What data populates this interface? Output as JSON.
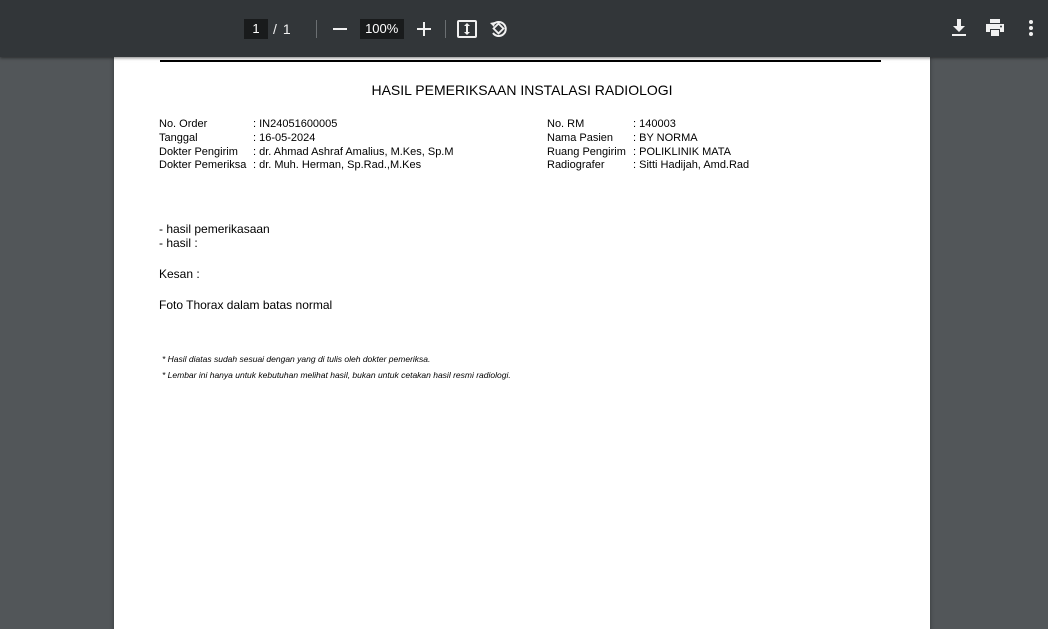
{
  "toolbar": {
    "page_current": "1",
    "page_separator": "/",
    "page_total": "1",
    "zoom": "100%",
    "icons": [
      "minus-icon",
      "plus-icon",
      "fit-page-icon",
      "rotate-icon",
      "download-icon",
      "print-icon",
      "more-vert-icon"
    ]
  },
  "document": {
    "title": "HASIL PEMERIKSAAN INSTALASI RADIOLOGI",
    "left_info": [
      {
        "label": "No. Order",
        "value": ": IN24051600005"
      },
      {
        "label": "Tanggal",
        "value": ": 16-05-2024"
      },
      {
        "label": "Dokter Pengirim",
        "value": ": dr. Ahmad Ashraf Amalius, M.Kes, Sp.M"
      },
      {
        "label": "Dokter Pemeriksa",
        "value": ": dr. Muh. Herman, Sp.Rad.,M.Kes"
      }
    ],
    "right_info": [
      {
        "label": "No. RM",
        "value": ": 140003"
      },
      {
        "label": "Nama Pasien",
        "value": ": BY NORMA"
      },
      {
        "label": "Ruang Pengirim",
        "value": ": POLIKLINIK MATA"
      },
      {
        "label": "Radiografer",
        "value": ": Sitti Hadijah, Amd.Rad"
      }
    ],
    "result_line_1": "- hasil pemerikasaan",
    "result_line_2": "- hasil :",
    "kesan_label": "Kesan :",
    "kesan_text": "Foto Thorax dalam batas normal",
    "note_1": "* Hasil diatas sudah sesuai dengan yang di tulis oleh dokter pemeriksa.",
    "note_2": "* Lembar ini hanya untuk kebutuhan melihat hasil, bukan untuk cetakan hasil resmi radiologi."
  }
}
